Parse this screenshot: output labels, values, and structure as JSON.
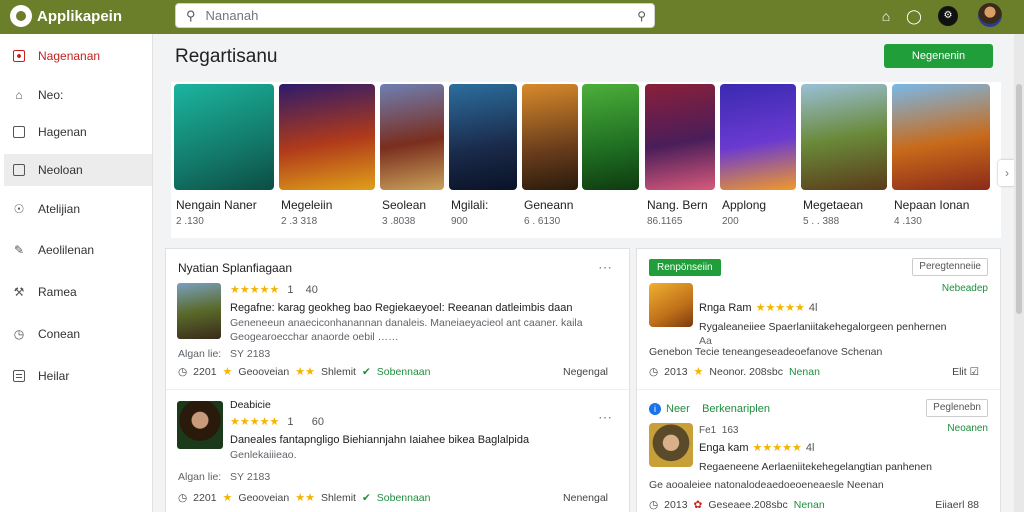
{
  "app": {
    "name": "Applikapein"
  },
  "search": {
    "placeholder": "Nananah"
  },
  "sidebar": {
    "items": [
      {
        "label": "Nagenanan",
        "icon": "store-icon"
      },
      {
        "label": "Neo:",
        "icon": "home-icon"
      },
      {
        "label": "Hagenan",
        "icon": "bookmark-icon"
      },
      {
        "label": "Neoloan",
        "icon": "square-icon"
      },
      {
        "label": "Atelijian",
        "icon": "compass-icon"
      },
      {
        "label": "Aeolilenan",
        "icon": "pen-icon"
      },
      {
        "label": "Ramea",
        "icon": "wrench-icon"
      },
      {
        "label": "Conean",
        "icon": "clock-icon"
      },
      {
        "label": "Heilar",
        "icon": "list-icon"
      }
    ]
  },
  "main": {
    "section_title": "Regartisanu",
    "top_button": "Negenenin",
    "carousel": [
      {
        "title": "Nengain Naner",
        "meta": "2 .130"
      },
      {
        "title": "Megeleiin",
        "meta": "2 .3 318"
      },
      {
        "title": "Seolean",
        "meta": "3 .8038"
      },
      {
        "title": "Mgilali:",
        "meta": "900"
      },
      {
        "title": "Geneann",
        "meta": "6 . 6130"
      },
      {
        "title": "Nang. Bern",
        "meta": "86.1165"
      },
      {
        "title": "Applong",
        "meta": "200"
      },
      {
        "title": "Megetaean",
        "meta": "5 . . 388"
      },
      {
        "title": "Nepaan Ionan",
        "meta": "4 .130"
      }
    ]
  },
  "reviews": {
    "title": "Nyatian Splanfiagaan",
    "items": [
      {
        "stars": "★★★★★",
        "rating": "1    40",
        "text": "Regafne: karag geokheg bao Regiekaeyoel: Reeanan datleimbis daan",
        "sub1": "Geneneeun anaeciconhanannan danaleis. Maneiaeyacieol ant caaner. kaila",
        "sub2": "Geogearoecchar anaorde oebil ……",
        "date": "Algan lie:   SY 2183",
        "footer_left": "2201",
        "footer_a": "Geooveian",
        "footer_b": "Shlemit",
        "footer_c": "Sobennaan",
        "footer_right": "Negengal"
      },
      {
        "name": "Deabicie",
        "stars": "★★★★★",
        "rating": "1      60",
        "text": "Daneales fantapngligo Biehiannjahn Iaiahee bikea Baglalpida",
        "sub1": "Genlekaiiieao.",
        "date": "Algan lie:   SY 2183",
        "footer_left": "2201",
        "footer_a": "Geooveian",
        "footer_b": "Shlemit",
        "footer_c": "Sobennaan",
        "footer_right": "Nenengal"
      }
    ]
  },
  "right": {
    "badge": "Renpönseiin",
    "items": [
      {
        "button": "Peregtenneiie",
        "status": "Nebeadep",
        "title": "Rnga Ram",
        "stars": "★★★★★",
        "rating": "4l",
        "text": "Rygaleaneiiee Spaerlaniitakehegalorgeen penhernen",
        "sub": "Aa",
        "line": "Genebon Tecie teneangeseadeoefanove Schenan",
        "footer_left": "2013",
        "footer_mid": "Neonor. 208sbc",
        "footer_name": "Nenan",
        "footer_right": "Elit"
      },
      {
        "header": "Neer    Berkenariplen",
        "button": "Peglenebn",
        "status": "Neoanen",
        "small": "Fe1  163",
        "title": "Enga kam",
        "stars": "★★★★★",
        "rating": "4l",
        "text": "Regaeneene Aerlaeniitekehegelangtian panhenen",
        "line": "Ge aooaleiee natonalodeaedoeoeneaesle Neenan",
        "footer_left": "2013",
        "footer_mid": "Geseaee.208sbc",
        "footer_name": "Nenan",
        "footer_right": "Eiiaerl 88"
      }
    ]
  },
  "colors": {
    "topbar": "#6b7f2a",
    "accent": "#1f9e3a",
    "active": "#c5221f",
    "star": "#f4b400"
  }
}
